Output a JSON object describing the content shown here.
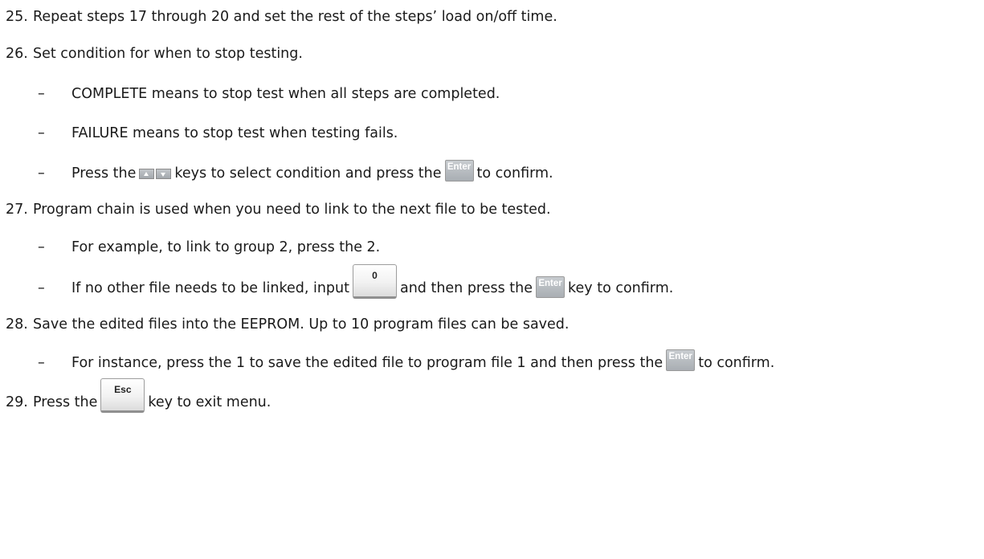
{
  "steps": {
    "s25": {
      "number": "25.",
      "text": "Repeat steps 17 through 20 and set the rest of the steps’ load on/off time."
    },
    "s26": {
      "number": "26.",
      "text": "Set condition for when to stop testing.",
      "bullets": [
        "COMPLETE means to stop test when all steps are completed.",
        "FAILURE means to stop test when testing fails."
      ],
      "press_bullet": {
        "before": "Press the",
        "middle": "keys to select condition and press the",
        "after": "to confirm."
      }
    },
    "s27": {
      "number": "27.",
      "text": "Program chain is used when you need to link to the next file to be tested.",
      "bullet1": "For example, to link to group 2, press the 2.",
      "bullet2": {
        "before": "If no other file needs to be linked, input",
        "middle": "and then press the",
        "after": "key to confirm."
      }
    },
    "s28": {
      "number": "28.",
      "text": "Save the edited files into the EEPROM. Up to 10 program files can be saved.",
      "bullet": {
        "before": "For instance, press the 1 to save the edited file to program file 1 and then press the",
        "after": "to confirm."
      }
    },
    "s29": {
      "number": "29.",
      "before": "Press the",
      "after": "key to exit menu."
    }
  },
  "keys": {
    "enter_label": "Enter",
    "zero_label": "0",
    "esc_label": "Esc",
    "arrow_up_icon": "arrow-up-icon",
    "arrow_down_icon": "arrow-down-icon"
  },
  "dash": "–"
}
